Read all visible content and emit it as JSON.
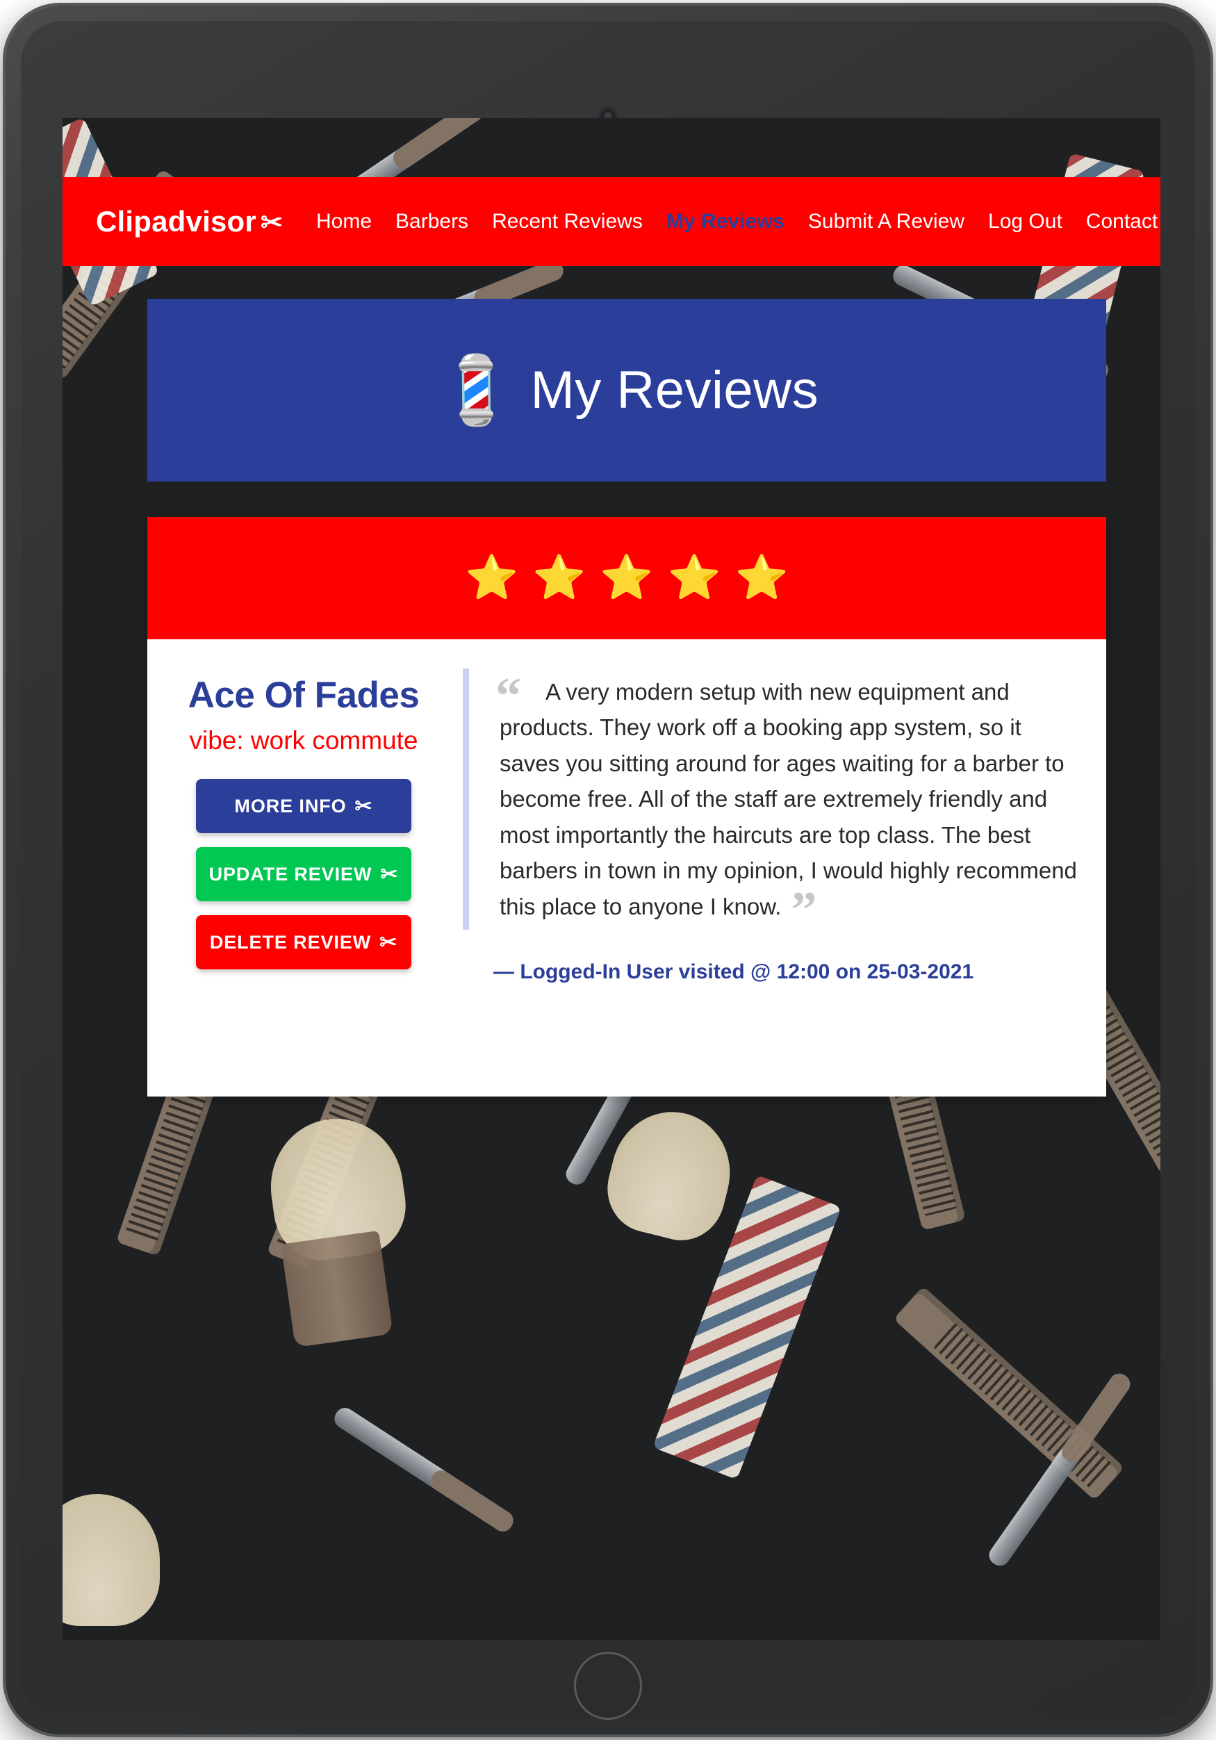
{
  "brand": {
    "name": "Clipadvisor",
    "icon": "scissors-icon",
    "icon_glyph": "✂"
  },
  "nav": {
    "items": [
      {
        "label": "Home",
        "active": false
      },
      {
        "label": "Barbers",
        "active": false
      },
      {
        "label": "Recent Reviews",
        "active": false
      },
      {
        "label": "My Reviews",
        "active": true
      },
      {
        "label": "Submit A Review",
        "active": false
      },
      {
        "label": "Log Out",
        "active": false
      },
      {
        "label": "Contact",
        "active": false
      }
    ]
  },
  "banner": {
    "title": "My Reviews",
    "icon": "barber-pole-icon",
    "icon_glyph": "💈"
  },
  "review": {
    "rating": 5,
    "rating_max": 5,
    "star_glyph": "⭐",
    "barber_name": "Ace Of Fades",
    "vibe": "vibe: work commute",
    "quote_open": "“",
    "quote_close": "”",
    "text": "A very modern setup with new equipment and products. They work off a booking app system, so it saves you sitting around for ages waiting for a barber to become free. All of the staff are extremely friendly and most importantly the haircuts are top class. The best barbers in town in my opinion, I would highly recommend this place to anyone I know.",
    "meta": "—  Logged-In User visited @ 12:00 on 25-03-2021",
    "actions": [
      {
        "label": "MORE INFO",
        "icon": "scissors-icon",
        "icon_glyph": "✂",
        "color": "#2b3e99"
      },
      {
        "label": "UPDATE REVIEW",
        "icon": "scissors-icon",
        "icon_glyph": "✂",
        "color": "#00c853"
      },
      {
        "label": "DELETE REVIEW",
        "icon": "scissors-icon",
        "icon_glyph": "✂",
        "color": "#ff0000"
      }
    ]
  },
  "colors": {
    "brand_red": "#ff0000",
    "brand_navy": "#2b3e99",
    "success_green": "#00c853",
    "star_yellow": "#ffd33d",
    "page_background": "#1e2022",
    "card_background": "#ffffff",
    "quote_border": "#c9d2f2"
  }
}
